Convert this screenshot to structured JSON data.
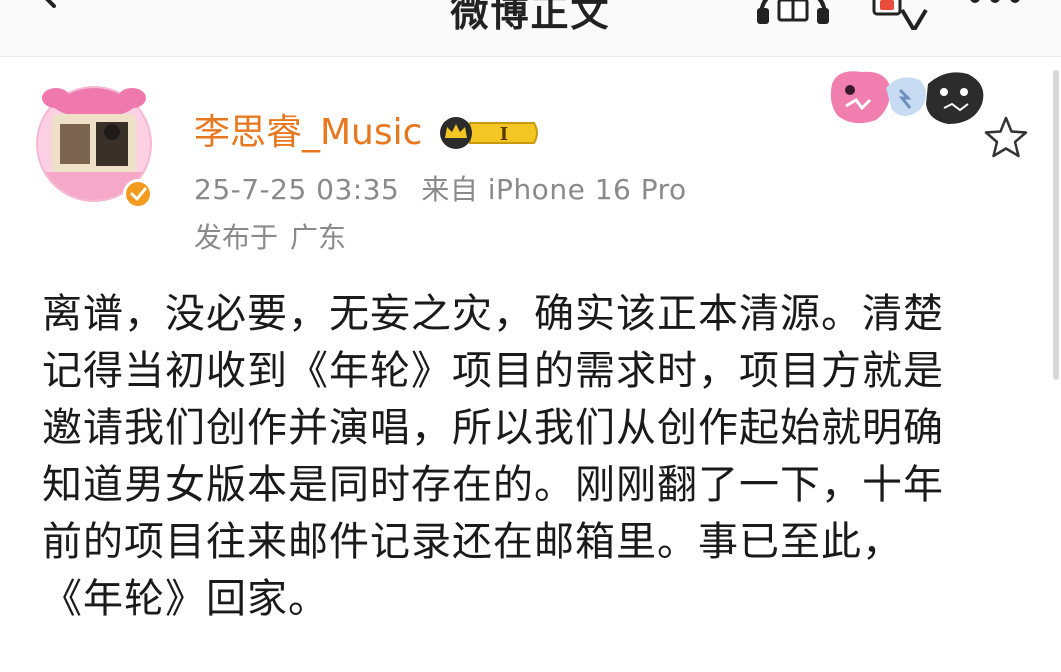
{
  "nav": {
    "title": "微博正文",
    "back_icon": "chevron-left-icon",
    "listen_icon": "listen-icon",
    "translate_icon": "translate-icon",
    "more_icon": "more-icon"
  },
  "author": {
    "name": "李思睿_Music",
    "badge": "I",
    "verified_icon": "verified-check-icon",
    "avatar_icon": "avatar-image",
    "name_color": "#e8781f"
  },
  "meta": {
    "time": "25-7-25 03:35",
    "source": "来自 iPhone 16 Pro",
    "location_label": "发布于",
    "location_value": "广东"
  },
  "actions": {
    "favorite_icon": "star-outline-icon",
    "decoration_icon": "card-decoration-stickers"
  },
  "post": {
    "lines": [
      "离谱，没必要，无妄之灾，确实该正本清源。清楚",
      "记得当初收到《年轮》项目的需求时，项目方就是",
      "邀请我们创作并演唱，所以我们从创作起始就明确",
      "知道男女版本是同时存在的。刚刚翻了一下，十年",
      "前的项目往来邮件记录还在邮箱里。事已至此，",
      "《年轮》回家。"
    ]
  },
  "colors": {
    "text": "#1a1a1a",
    "meta": "#8a8a8a",
    "accent": "#e8781f",
    "badge_gold": "#f3c623"
  }
}
